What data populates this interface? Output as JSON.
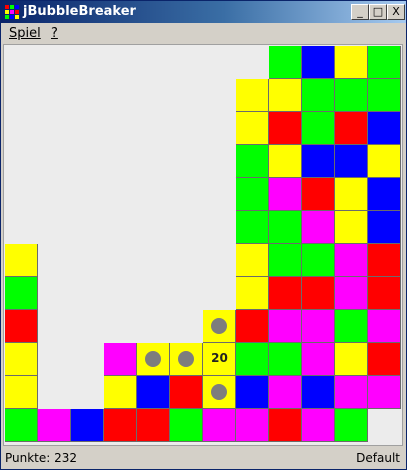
{
  "window": {
    "title": "jBubbleBreaker",
    "controls": [
      "_",
      "□",
      "X"
    ]
  },
  "menu": [
    {
      "label": "Spiel"
    },
    {
      "label": "?"
    }
  ],
  "colors": {
    "G": "#00ff00",
    "B": "#0000ff",
    "Y": "#ffff00",
    "R": "#ff0000",
    "M": "#ff00ff"
  },
  "board": {
    "rows": [
      "........GBYG",
      ".......YYGGG",
      ".......YRGRB",
      ".......GYBBY",
      ".......GMRYB",
      ".......GGMYB",
      "Y......YGGMR",
      "G......YRRMR",
      "R.....YRMMGM",
      "Y..MYYYGGMYR",
      "Y..YBRYBMBMM",
      "GMBRRGMMRMG."
    ],
    "selected": [
      [
        8,
        6
      ],
      [
        9,
        4
      ],
      [
        9,
        5
      ],
      [
        9,
        6
      ],
      [
        10,
        6
      ]
    ],
    "selection_count": "20",
    "count_cell": [
      9,
      6
    ]
  },
  "status": {
    "score": "Punkte: 232",
    "mode": "Default"
  }
}
